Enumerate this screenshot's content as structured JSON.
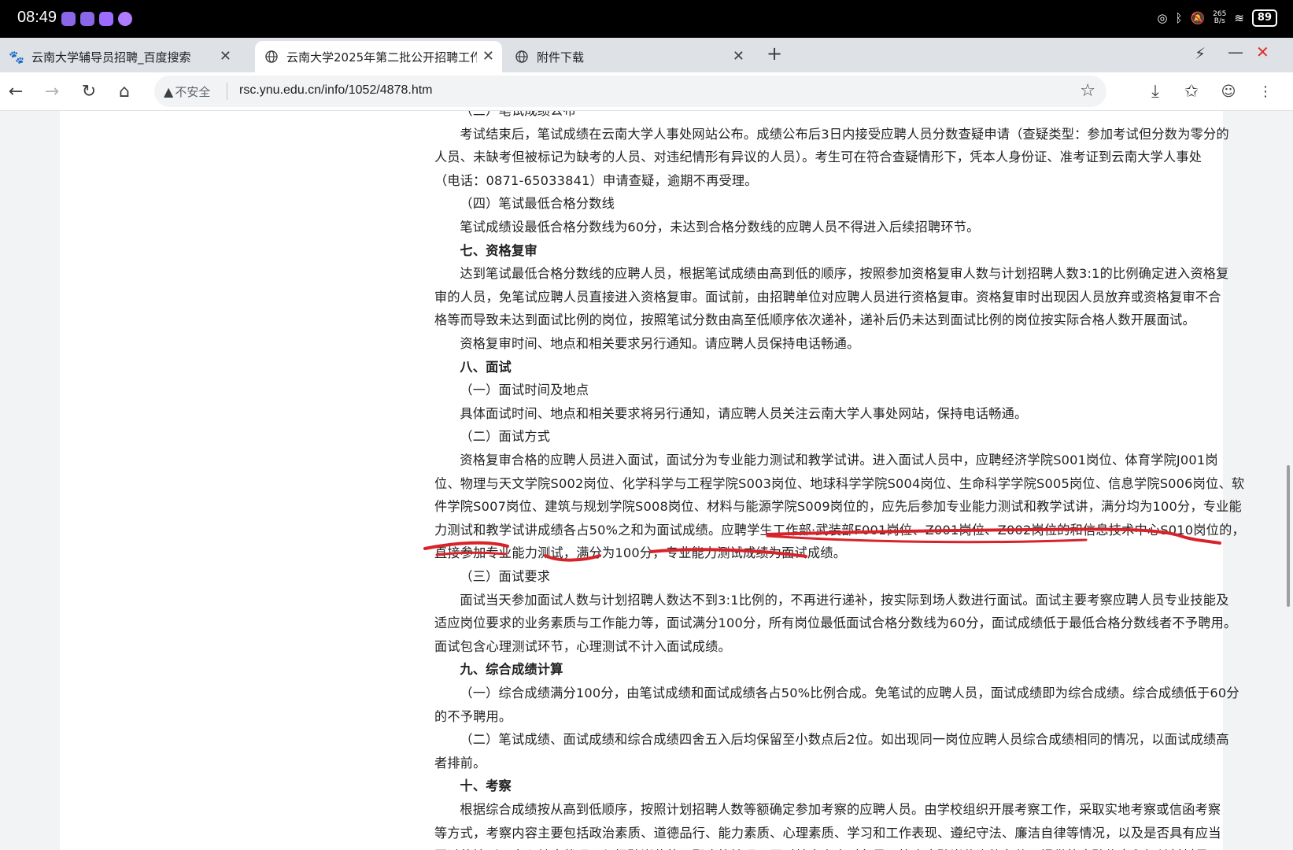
{
  "status_bar": {
    "time": "08:49",
    "network_speed_top": "265",
    "network_speed_bottom": "B/s",
    "battery": "89"
  },
  "tabs": [
    {
      "title": "云南大学辅导员招聘_百度搜索",
      "icon": "baidu-paw-icon",
      "active": false
    },
    {
      "title": "云南大学2025年第二批公开招聘工作",
      "icon": "globe-icon",
      "active": true
    },
    {
      "title": "附件下载",
      "icon": "globe-icon",
      "active": false
    }
  ],
  "tab_close_glyph": "✕",
  "new_tab_glyph": "+",
  "toolbar": {
    "security_label": "不安全",
    "url": "rsc.ynu.edu.cn/info/1052/4878.htm"
  },
  "article_lines": [
    {
      "text": "（三）笔试成绩公布",
      "indent": 2,
      "bold": false
    },
    {
      "text": "考试结束后，笔试成绩在云南大学人事处网站公布。成绩公布后3日内接受应聘人员分数查疑申请（查疑类型：参加考试但分数为零分的",
      "indent": 2,
      "bold": false
    },
    {
      "text": "人员、未缺考但被标记为缺考的人员、对违纪情形有异议的人员）。考生可在符合查疑情形下，凭本人身份证、准考证到云南大学人事处",
      "indent": 0,
      "bold": false
    },
    {
      "text": "（电话：0871-65033841）申请查疑，逾期不再受理。",
      "indent": 0,
      "bold": false
    },
    {
      "text": "（四）笔试最低合格分数线",
      "indent": 2,
      "bold": false
    },
    {
      "text": "笔试成绩设最低合格分数线为60分，未达到合格分数线的应聘人员不得进入后续招聘环节。",
      "indent": 2,
      "bold": false
    },
    {
      "text": "七、资格复审",
      "indent": 2,
      "bold": true
    },
    {
      "text": "达到笔试最低合格分数线的应聘人员，根据笔试成绩由高到低的顺序，按照参加资格复审人数与计划招聘人数3:1的比例确定进入资格复",
      "indent": 2,
      "bold": false
    },
    {
      "text": "审的人员，免笔试应聘人员直接进入资格复审。面试前，由招聘单位对应聘人员进行资格复审。资格复审时出现因人员放弃或资格复审不合",
      "indent": 0,
      "bold": false
    },
    {
      "text": "格等而导致未达到面试比例的岗位，按照笔试分数由高至低顺序依次递补，递补后仍未达到面试比例的岗位按实际合格人数开展面试。",
      "indent": 0,
      "bold": false
    },
    {
      "text": "资格复审时间、地点和相关要求另行通知。请应聘人员保持电话畅通。",
      "indent": 2,
      "bold": false
    },
    {
      "text": "八、面试",
      "indent": 2,
      "bold": true
    },
    {
      "text": "（一）面试时间及地点",
      "indent": 2,
      "bold": false
    },
    {
      "text": "具体面试时间、地点和相关要求将另行通知，请应聘人员关注云南大学人事处网站，保持电话畅通。",
      "indent": 2,
      "bold": false
    },
    {
      "text": "（二）面试方式",
      "indent": 2,
      "bold": false
    },
    {
      "text": "资格复审合格的应聘人员进入面试，面试分为专业能力测试和教学试讲。进入面试人员中，应聘经济学院S001岗位、体育学院J001岗",
      "indent": 2,
      "bold": false
    },
    {
      "text": "位、物理与天文学院S002岗位、化学科学与工程学院S003岗位、地球科学学院S004岗位、生命科学学院S005岗位、信息学院S006岗位、软",
      "indent": 0,
      "bold": false
    },
    {
      "text": "件学院S007岗位、建筑与规划学院S008岗位、材料与能源学院S009岗位的，应先后参加专业能力测试和教学试讲，满分均为100分，专业能",
      "indent": 0,
      "bold": false
    },
    {
      "text": "力测试和教学试讲成绩各占50%之和为面试成绩。应聘学生工作部·武装部F001岗位、Z001岗位、Z002岗位的和信息技术中心S010岗位的，",
      "indent": 0,
      "bold": false
    },
    {
      "text": "直接参加专业能力测试，满分为100分，专业能力测试成绩为面试成绩。",
      "indent": 0,
      "bold": false
    },
    {
      "text": "（三）面试要求",
      "indent": 2,
      "bold": false
    },
    {
      "text": "面试当天参加面试人数与计划招聘人数达不到3:1比例的，不再进行递补，按实际到场人数进行面试。面试主要考察应聘人员专业技能及",
      "indent": 2,
      "bold": false
    },
    {
      "text": "适应岗位要求的业务素质与工作能力等，面试满分100分，所有岗位最低面试合格分数线为60分，面试成绩低于最低合格分数线者不予聘用。",
      "indent": 0,
      "bold": false
    },
    {
      "text": "面试包含心理测试环节，心理测试不计入面试成绩。",
      "indent": 0,
      "bold": false
    },
    {
      "text": "九、综合成绩计算",
      "indent": 2,
      "bold": true
    },
    {
      "text": "（一）综合成绩满分100分，由笔试成绩和面试成绩各占50%比例合成。免笔试的应聘人员，面试成绩即为综合成绩。综合成绩低于60分",
      "indent": 2,
      "bold": false
    },
    {
      "text": "的不予聘用。",
      "indent": 0,
      "bold": false
    },
    {
      "text": "（二）笔试成绩、面试成绩和综合成绩四舍五入后均保留至小数点后2位。如出现同一岗位应聘人员综合成绩相同的情况，以面试成绩高",
      "indent": 2,
      "bold": false
    },
    {
      "text": "者排前。",
      "indent": 0,
      "bold": false
    },
    {
      "text": "十、考察",
      "indent": 2,
      "bold": true
    },
    {
      "text": "根据综合成绩按从高到低顺序，按照计划招聘人数等额确定参加考察的应聘人员。由学校组织开展考察工作，采取实地考察或信函考察",
      "indent": 2,
      "bold": false
    },
    {
      "text": "等方式，考察内容主要包括政治素质、道德品行、能力素质、心理素质、学习和工作表现、遵纪守法、廉洁自律等情况，以及是否具有应当",
      "indent": 0,
      "bold": false
    },
    {
      "text": "回避的情形、身心健康状况、与招聘岗位的匹配度等情况，同时核实考察对象是否符合应聘岗位资格条件，提供的应聘信息和相关材料是否",
      "indent": 0,
      "bold": false
    }
  ],
  "accent_colors": {
    "ink": "#d8232a",
    "page_bg": "#ffffff",
    "chrome_bg": "#dee1e6"
  }
}
